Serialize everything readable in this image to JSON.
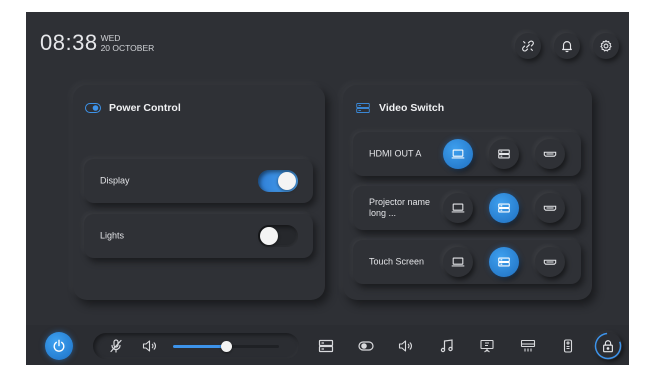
{
  "header": {
    "time": "08:38",
    "weekday": "WED",
    "date": "20 OCTOBER",
    "icons": [
      "unlink-icon",
      "bell-icon",
      "gear-icon"
    ]
  },
  "power_control": {
    "title": "Power Control",
    "rows": [
      {
        "label": "Display",
        "on": true
      },
      {
        "label": "Lights",
        "on": false
      }
    ]
  },
  "video_switch": {
    "title": "Video Switch",
    "outputs": [
      {
        "label": "HDMI OUT A",
        "active_source": "laptop"
      },
      {
        "label": "Projector name long ...",
        "active_source": "camera"
      },
      {
        "label": "Touch Screen",
        "active_source": "camera"
      }
    ],
    "sources": [
      "laptop-icon",
      "camera-icon",
      "hdmi-icon"
    ]
  },
  "bottom_bar": {
    "volume_level": 0.5,
    "icons": [
      "power-icon",
      "mic-muted-icon",
      "speaker-icon",
      "video-switch-icon",
      "power-toggle-icon",
      "audio-icon",
      "music-icon",
      "presentation-icon",
      "projector-icon",
      "remote-icon",
      "lock-icon"
    ]
  },
  "colors": {
    "accent": "#3d93ea",
    "background": "#2e3035",
    "text": "#e6e7ea"
  }
}
